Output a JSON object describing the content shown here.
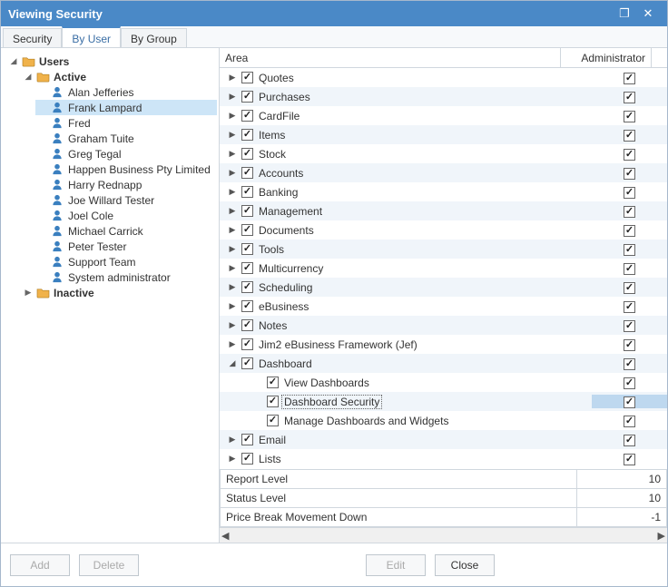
{
  "window": {
    "title": "Viewing Security"
  },
  "tabs": [
    "Security",
    "By User",
    "By Group"
  ],
  "activeTab": 1,
  "tree": {
    "root": "Users",
    "active": "Active",
    "inactive": "Inactive",
    "users": [
      "Alan Jefferies",
      "Frank Lampard",
      "Fred",
      "Graham Tuite",
      "Greg Tegal",
      "Happen Business Pty Limited",
      "Harry Rednapp",
      "Joe Willard Tester",
      "Joel Cole",
      "Michael Carrick",
      "Peter Tester",
      "Support Team",
      "System administrator"
    ],
    "selected": "Frank Lampard"
  },
  "grid": {
    "headers": {
      "area": "Area",
      "admin": "Administrator"
    },
    "rows": [
      {
        "label": "Quotes",
        "indent": 0,
        "exp": "▶",
        "areaChecked": true,
        "adminChecked": true
      },
      {
        "label": "Purchases",
        "indent": 0,
        "exp": "▶",
        "areaChecked": true,
        "adminChecked": true
      },
      {
        "label": "CardFile",
        "indent": 0,
        "exp": "▶",
        "areaChecked": true,
        "adminChecked": true
      },
      {
        "label": "Items",
        "indent": 0,
        "exp": "▶",
        "areaChecked": true,
        "adminChecked": true
      },
      {
        "label": "Stock",
        "indent": 0,
        "exp": "▶",
        "areaChecked": true,
        "adminChecked": true
      },
      {
        "label": "Accounts",
        "indent": 0,
        "exp": "▶",
        "areaChecked": true,
        "adminChecked": true
      },
      {
        "label": "Banking",
        "indent": 0,
        "exp": "▶",
        "areaChecked": true,
        "adminChecked": true
      },
      {
        "label": "Management",
        "indent": 0,
        "exp": "▶",
        "areaChecked": true,
        "adminChecked": true
      },
      {
        "label": "Documents",
        "indent": 0,
        "exp": "▶",
        "areaChecked": true,
        "adminChecked": true
      },
      {
        "label": "Tools",
        "indent": 0,
        "exp": "▶",
        "areaChecked": true,
        "adminChecked": true
      },
      {
        "label": "Multicurrency",
        "indent": 0,
        "exp": "▶",
        "areaChecked": true,
        "adminChecked": true
      },
      {
        "label": "Scheduling",
        "indent": 0,
        "exp": "▶",
        "areaChecked": true,
        "adminChecked": true
      },
      {
        "label": "eBusiness",
        "indent": 0,
        "exp": "▶",
        "areaChecked": true,
        "adminChecked": true
      },
      {
        "label": "Notes",
        "indent": 0,
        "exp": "▶",
        "areaChecked": true,
        "adminChecked": true
      },
      {
        "label": "Jim2 eBusiness Framework (Jef)",
        "indent": 0,
        "exp": "▶",
        "areaChecked": true,
        "adminChecked": true
      },
      {
        "label": "Dashboard",
        "indent": 0,
        "exp": "◢",
        "areaChecked": true,
        "adminChecked": true
      },
      {
        "label": "View Dashboards",
        "indent": 1,
        "exp": "",
        "areaChecked": true,
        "adminChecked": true
      },
      {
        "label": "Dashboard Security",
        "indent": 1,
        "exp": "",
        "areaChecked": true,
        "adminChecked": true,
        "selected": true
      },
      {
        "label": "Manage Dashboards and Widgets",
        "indent": 1,
        "exp": "",
        "areaChecked": true,
        "adminChecked": true
      },
      {
        "label": "Email",
        "indent": 0,
        "exp": "▶",
        "areaChecked": true,
        "adminChecked": true
      },
      {
        "label": "Lists",
        "indent": 0,
        "exp": "▶",
        "areaChecked": true,
        "adminChecked": true
      }
    ],
    "summary": [
      {
        "label": "Report Level",
        "value": "10"
      },
      {
        "label": "Status Level",
        "value": "10"
      },
      {
        "label": "Price Break Movement Down",
        "value": "-1"
      }
    ]
  },
  "buttons": {
    "add": "Add",
    "delete": "Delete",
    "edit": "Edit",
    "close": "Close"
  }
}
